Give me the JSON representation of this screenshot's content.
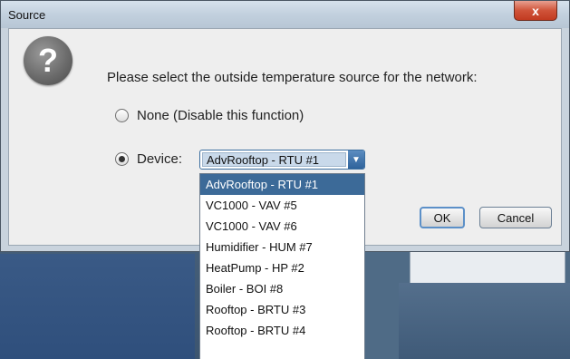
{
  "window": {
    "title": "Source",
    "close_glyph": "x"
  },
  "dialog": {
    "icon": "question-icon",
    "icon_glyph": "?",
    "prompt": "Please select the outside temperature source for the network:",
    "options": {
      "none_label": "None (Disable this function)",
      "device_label": "Device:",
      "selected_option": "device"
    },
    "device_select": {
      "value": "AdvRooftop - RTU #1",
      "arrow_glyph": "▼",
      "items": [
        "AdvRooftop - RTU #1",
        "VC1000 - VAV #5",
        "VC1000 - VAV #6",
        "Humidifier - HUM #7",
        "HeatPump - HP #2",
        "Boiler - BOI #8",
        "Rooftop - BRTU #3",
        "Rooftop - BRTU #4"
      ],
      "highlighted_index": 0
    },
    "buttons": {
      "ok": "OK",
      "cancel": "Cancel"
    }
  },
  "colors": {
    "selection": "#3c6a98",
    "close_button": "#c23a20",
    "dialog_bg": "#eeeeee"
  }
}
